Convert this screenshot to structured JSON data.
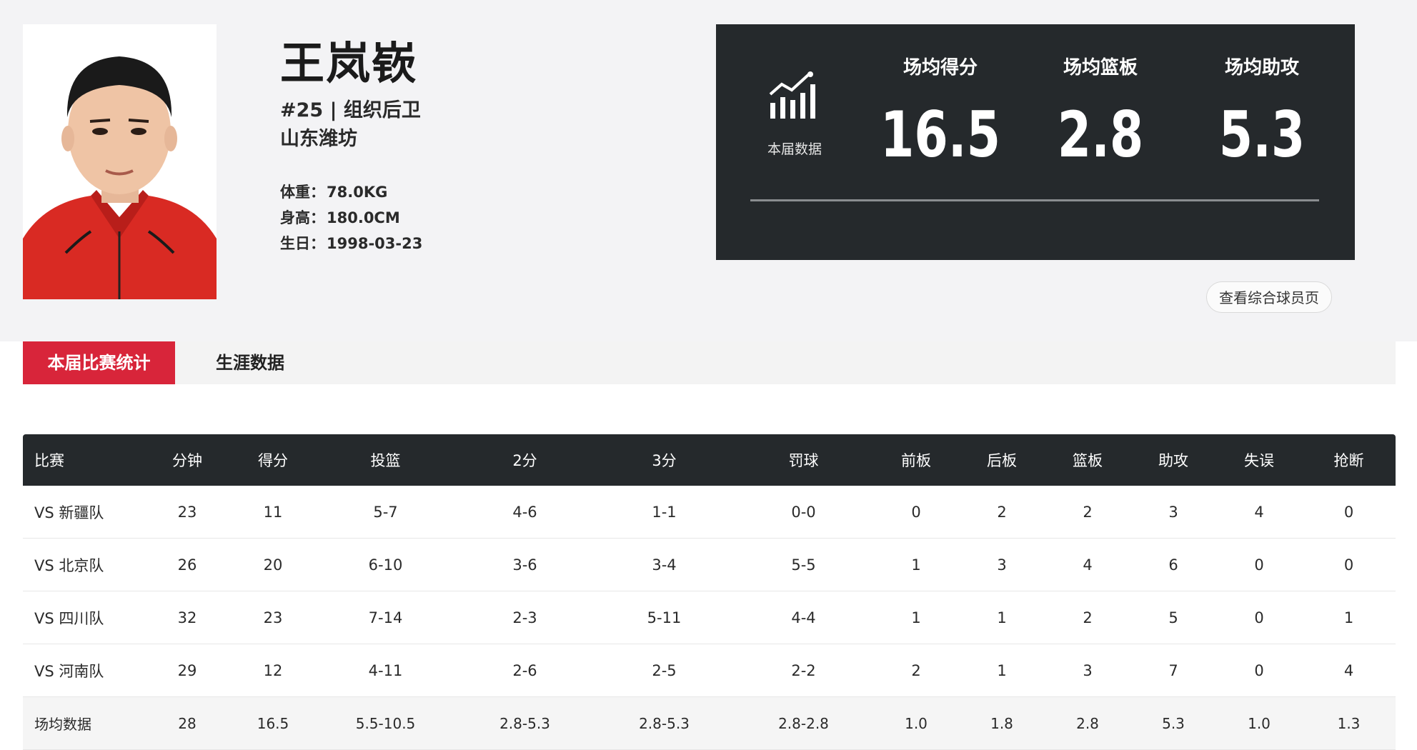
{
  "player": {
    "name": "王岚嵚",
    "number_position": "#25 | 组织后卫",
    "team": "山东潍坊",
    "weight_label": "体重：",
    "weight": "78.0KG",
    "height_label": "身高：",
    "height": "180.0CM",
    "birth_label": "生日：",
    "birth": "1998-03-23"
  },
  "season_panel": {
    "caption": "本届数据",
    "icon": "bar-chart-trend-icon",
    "stats": [
      {
        "label": "场均得分",
        "value": "16.5"
      },
      {
        "label": "场均篮板",
        "value": "2.8"
      },
      {
        "label": "场均助攻",
        "value": "5.3"
      }
    ]
  },
  "profile_link": "查看综合球员页",
  "tabs": [
    {
      "label": "本届比赛统计",
      "active": true
    },
    {
      "label": "生涯数据",
      "active": false
    }
  ],
  "colors": {
    "accent": "#d8253a",
    "panel_bg": "#25292c"
  },
  "table": {
    "headers": [
      "比赛",
      "分钟",
      "得分",
      "投篮",
      "2分",
      "3分",
      "罚球",
      "前板",
      "后板",
      "篮板",
      "助攻",
      "失误",
      "抢断"
    ],
    "rows": [
      [
        "VS 新疆队",
        "23",
        "11",
        "5-7",
        "4-6",
        "1-1",
        "0-0",
        "0",
        "2",
        "2",
        "3",
        "4",
        "0"
      ],
      [
        "VS 北京队",
        "26",
        "20",
        "6-10",
        "3-6",
        "3-4",
        "5-5",
        "1",
        "3",
        "4",
        "6",
        "0",
        "0"
      ],
      [
        "VS 四川队",
        "32",
        "23",
        "7-14",
        "2-3",
        "5-11",
        "4-4",
        "1",
        "1",
        "2",
        "5",
        "0",
        "1"
      ],
      [
        "VS 河南队",
        "29",
        "12",
        "4-11",
        "2-6",
        "2-5",
        "2-2",
        "2",
        "1",
        "3",
        "7",
        "0",
        "4"
      ]
    ],
    "average": [
      "场均数据",
      "28",
      "16.5",
      "5.5-10.5",
      "2.8-5.3",
      "2.8-5.3",
      "2.8-2.8",
      "1.0",
      "1.8",
      "2.8",
      "5.3",
      "1.0",
      "1.3"
    ]
  }
}
